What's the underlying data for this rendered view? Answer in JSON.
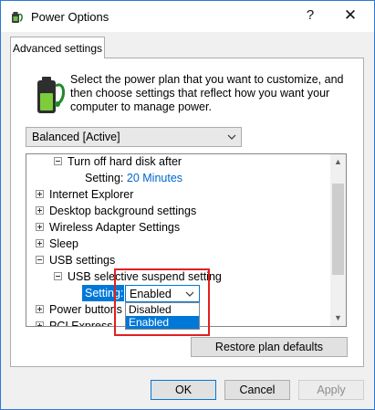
{
  "window": {
    "title": "Power Options",
    "help_glyph": "?",
    "close_glyph": "✕"
  },
  "tab": {
    "label": "Advanced settings"
  },
  "header": {
    "description": "Select the power plan that you want to customize, and then choose settings that reflect how you want your computer to manage power."
  },
  "plan_select": {
    "value": "Balanced [Active]"
  },
  "tree": {
    "items": [
      {
        "label": "Turn off hard disk after",
        "expander": "minus"
      },
      {
        "label": "Setting:",
        "value": "20 Minutes"
      },
      {
        "label": "Internet Explorer",
        "expander": "plus"
      },
      {
        "label": "Desktop background settings",
        "expander": "plus"
      },
      {
        "label": "Wireless Adapter Settings",
        "expander": "plus"
      },
      {
        "label": "Sleep",
        "expander": "plus"
      },
      {
        "label": "USB settings",
        "expander": "minus"
      },
      {
        "label": "USB selective suspend setting",
        "expander": "minus"
      },
      {
        "label": "Setting:"
      },
      {
        "label": "Power buttons and lid",
        "expander": "plus"
      },
      {
        "label": "PCI Express",
        "expander": "plus"
      }
    ]
  },
  "setting_editor": {
    "selected": "Enabled",
    "options": [
      "Disabled",
      "Enabled"
    ]
  },
  "buttons": {
    "restore": "Restore plan defaults",
    "ok": "OK",
    "cancel": "Cancel",
    "apply": "Apply"
  },
  "colors": {
    "selection": "#0078d7",
    "callout": "#e02020",
    "link": "#0066cc"
  }
}
